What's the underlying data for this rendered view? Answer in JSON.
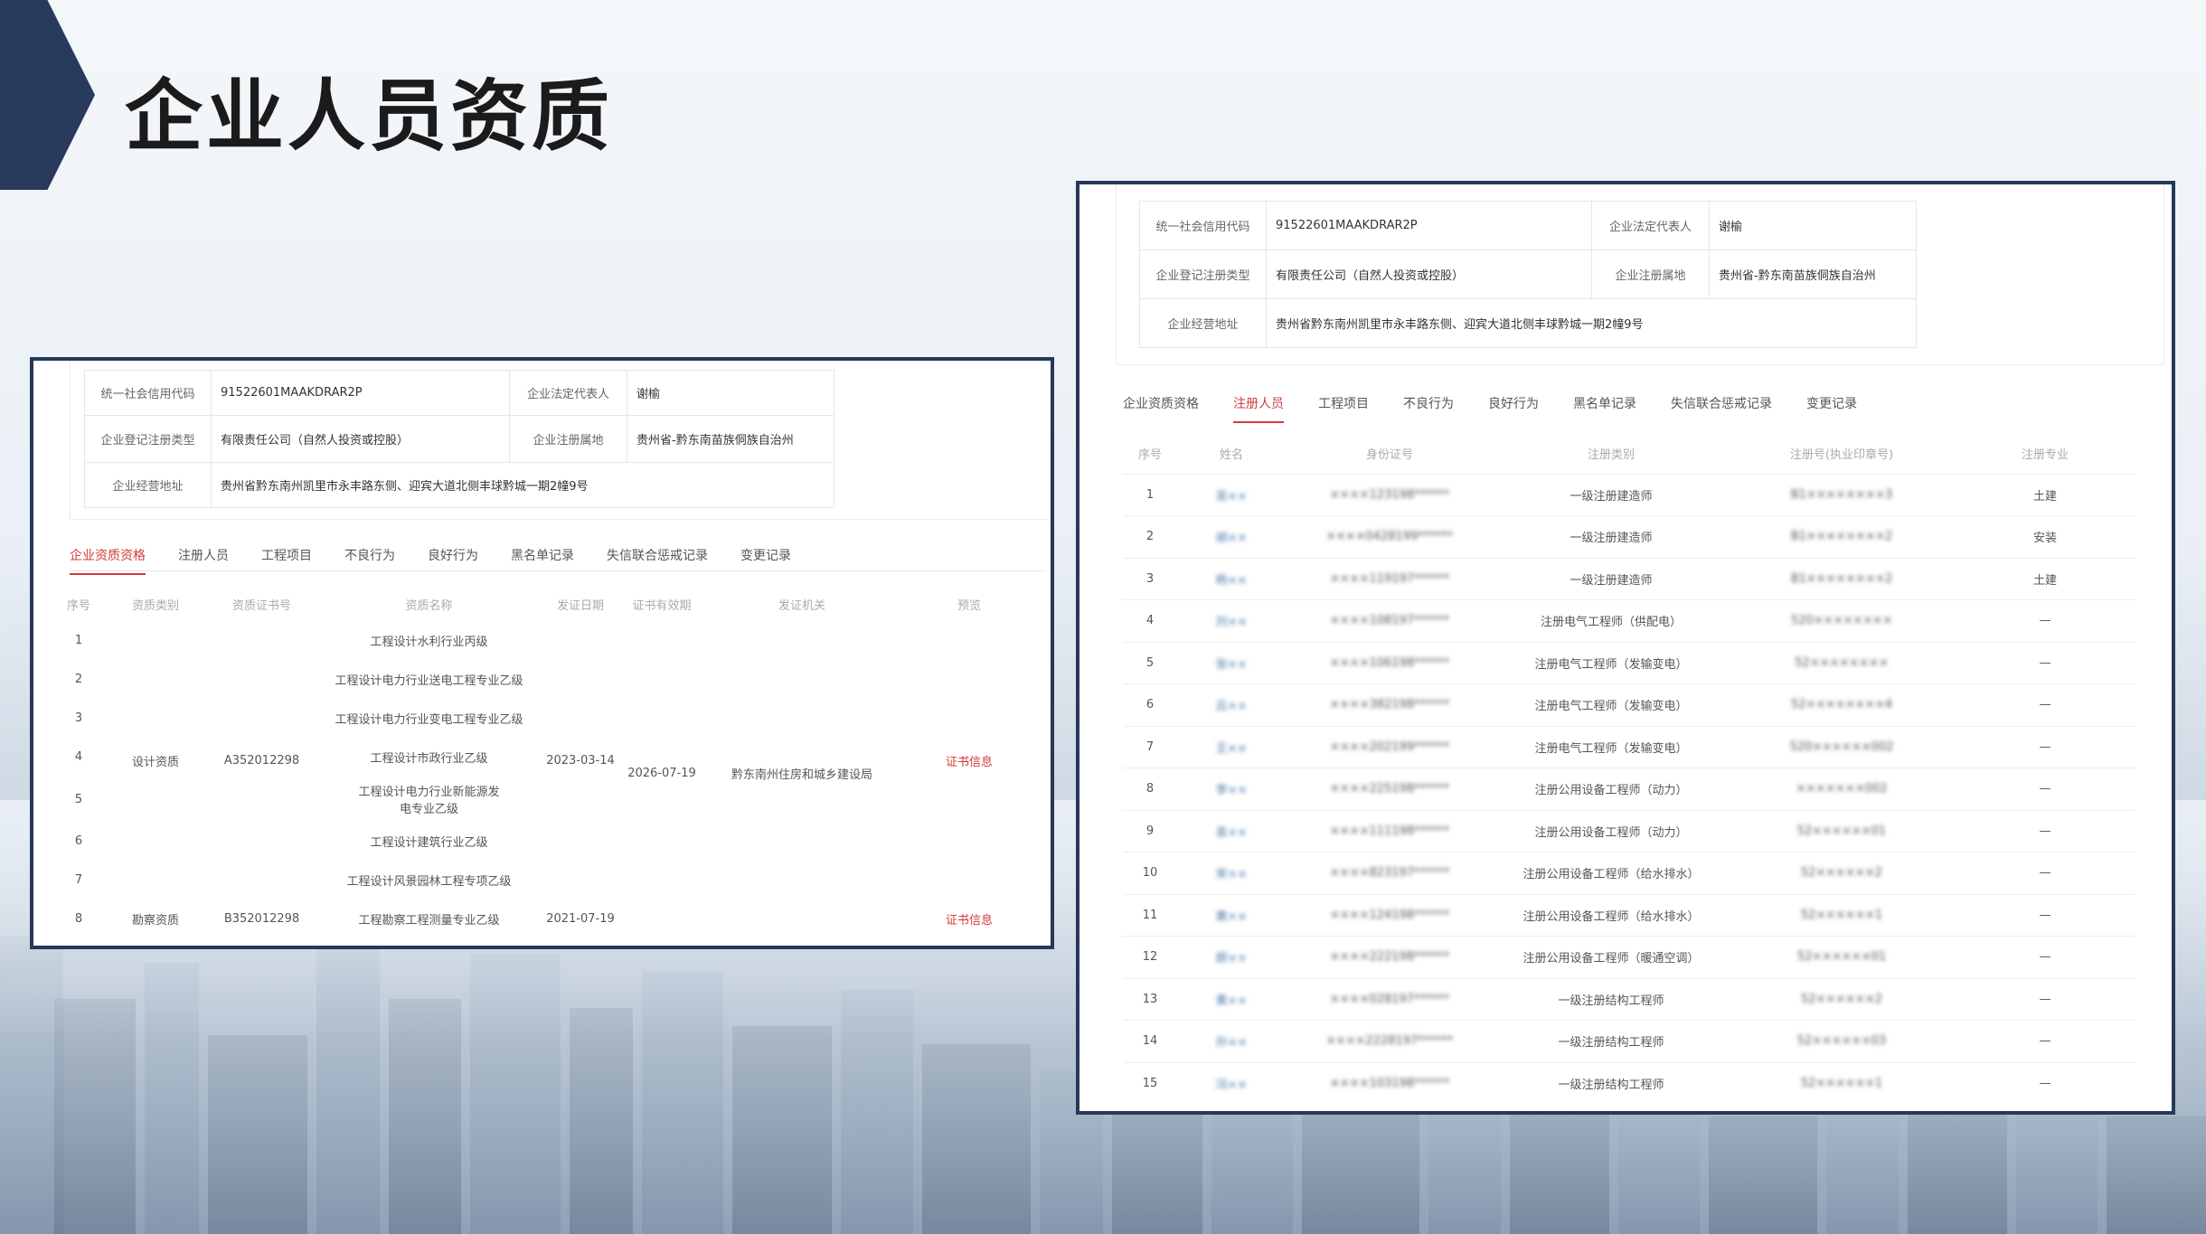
{
  "slide": {
    "title": "企业人员资质"
  },
  "panel_left": {
    "info": {
      "credit_code_label": "统一社会信用代码",
      "credit_code": "91522601MAAKDRAR2P",
      "legal_rep_label": "企业法定代表人",
      "legal_rep": "谢榆",
      "reg_type_label": "企业登记注册类型",
      "reg_type": "有限责任公司（自然人投资或控股）",
      "reg_place_label": "企业注册属地",
      "reg_place": "贵州省-黔东南苗族侗族自治州",
      "address_label": "企业经营地址",
      "address": "贵州省黔东南州凯里市永丰路东侧、迎宾大道北侧丰球黔城一期2幢9号"
    },
    "tabs": [
      "企业资质资格",
      "注册人员",
      "工程项目",
      "不良行为",
      "良好行为",
      "黑名单记录",
      "失信联合惩戒记录",
      "变更记录"
    ],
    "active_tab": "企业资质资格",
    "table": {
      "headers": [
        "序号",
        "资质类别",
        "资质证书号",
        "资质名称",
        "发证日期",
        "证书有效期",
        "发证机关",
        "预览"
      ],
      "rows": [
        {
          "no": "1",
          "name": "工程设计水利行业丙级"
        },
        {
          "no": "2",
          "name": "工程设计电力行业送电工程专业乙级"
        },
        {
          "no": "3",
          "name": "工程设计电力行业变电工程专业乙级"
        },
        {
          "no": "4",
          "name": "工程设计市政行业乙级"
        },
        {
          "no": "5",
          "name": "工程设计电力行业新能源发电专业乙级"
        },
        {
          "no": "6",
          "name": "工程设计建筑行业乙级"
        },
        {
          "no": "7",
          "name": "工程设计风景园林工程专项乙级"
        },
        {
          "no": "8",
          "name": "工程勘察工程测量专业乙级"
        }
      ],
      "group1": {
        "category": "设计资质",
        "cert_no": "A352012298",
        "issue_date": "2023-03-14",
        "valid_until": "2026-07-19",
        "authority": "黔东南州住房和城乡建设局",
        "preview": "证书信息"
      },
      "group2": {
        "category": "勘察资质",
        "cert_no": "B352012298",
        "issue_date": "2021-07-19",
        "preview": "证书信息"
      }
    }
  },
  "panel_right": {
    "info": {
      "credit_code_label": "统一社会信用代码",
      "credit_code": "91522601MAAKDRAR2P",
      "legal_rep_label": "企业法定代表人",
      "legal_rep": "谢榆",
      "reg_type_label": "企业登记注册类型",
      "reg_type": "有限责任公司（自然人投资或控股）",
      "reg_place_label": "企业注册属地",
      "reg_place": "贵州省-黔东南苗族侗族自治州",
      "address_label": "企业经营地址",
      "address": "贵州省黔东南州凯里市永丰路东侧、迎宾大道北侧丰球黔城一期2幢9号"
    },
    "tabs": [
      "企业资质资格",
      "注册人员",
      "工程项目",
      "不良行为",
      "良好行为",
      "黑名单记录",
      "失信联合惩戒记录",
      "变更记录"
    ],
    "active_tab": "注册人员",
    "table": {
      "headers": [
        "序号",
        "姓名",
        "身份证号",
        "注册类别",
        "注册号(执业印章号)",
        "注册专业"
      ],
      "rows": [
        {
          "no": "1",
          "name": "吴××",
          "id": "××××123198******",
          "category": "一级注册建造师",
          "reg_no": "B1××××××××3",
          "major": "土建"
        },
        {
          "no": "2",
          "name": "胡××",
          "id": "××××0428199******",
          "category": "一级注册建造师",
          "reg_no": "B1××××××××2",
          "major": "安装"
        },
        {
          "no": "3",
          "name": "杨××",
          "id": "××××119197******",
          "category": "一级注册建造师",
          "reg_no": "B1××××××××2",
          "major": "土建"
        },
        {
          "no": "4",
          "name": "刘××",
          "id": "××××108197******",
          "category": "注册电气工程师（供配电）",
          "reg_no": "520××××××××",
          "major": "—"
        },
        {
          "no": "5",
          "name": "张××",
          "id": "××××106198******",
          "category": "注册电气工程师（发输变电）",
          "reg_no": "52××××××××",
          "major": "—"
        },
        {
          "no": "6",
          "name": "吕××",
          "id": "××××382198******",
          "category": "注册电气工程师（发输变电）",
          "reg_no": "52××××××××4",
          "major": "—"
        },
        {
          "no": "7",
          "name": "王××",
          "id": "××××202199******",
          "category": "注册电气工程师（发输变电）",
          "reg_no": "520××××××002",
          "major": "—"
        },
        {
          "no": "8",
          "name": "李××",
          "id": "××××225198******",
          "category": "注册公用设备工程师（动力）",
          "reg_no": "×××××××002",
          "major": "—"
        },
        {
          "no": "9",
          "name": "袁××",
          "id": "××××111198******",
          "category": "注册公用设备工程师（动力）",
          "reg_no": "52××××××01",
          "major": "—"
        },
        {
          "no": "10",
          "name": "宋××",
          "id": "××××823197******",
          "category": "注册公用设备工程师（给水排水）",
          "reg_no": "52××××××2",
          "major": "—"
        },
        {
          "no": "11",
          "name": "黄××",
          "id": "××××124198******",
          "category": "注册公用设备工程师（给水排水）",
          "reg_no": "52××××××1",
          "major": "—"
        },
        {
          "no": "12",
          "name": "顾××",
          "id": "××××222198******",
          "category": "注册公用设备工程师（暖通空调）",
          "reg_no": "52××××××01",
          "major": "—"
        },
        {
          "no": "13",
          "name": "黄××",
          "id": "××××028197******",
          "category": "一级注册结构工程师",
          "reg_no": "52××××××2",
          "major": "—"
        },
        {
          "no": "14",
          "name": "孙××",
          "id": "××××2228197******",
          "category": "一级注册结构工程师",
          "reg_no": "52××××××03",
          "major": "—"
        },
        {
          "no": "15",
          "name": "冯××",
          "id": "××××103198******",
          "category": "一级注册结构工程师",
          "reg_no": "52××××××1",
          "major": "—"
        }
      ]
    }
  }
}
